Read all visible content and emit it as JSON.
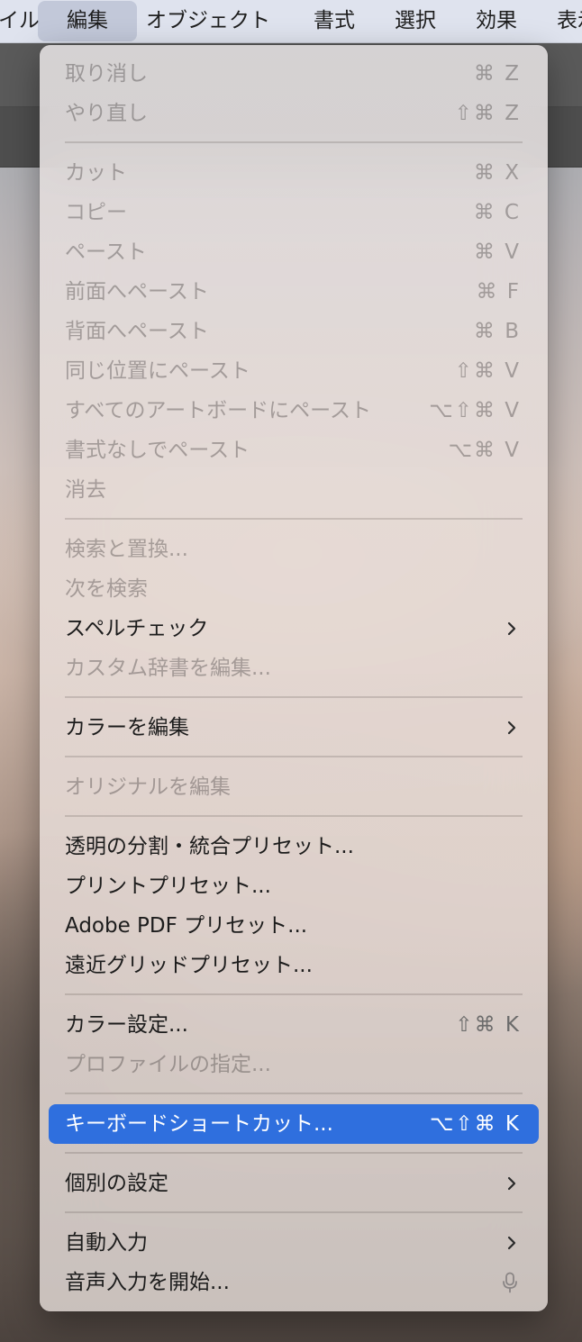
{
  "menubar": {
    "items": [
      {
        "label": "イル"
      },
      {
        "label": "編集"
      },
      {
        "label": "オブジェクト"
      },
      {
        "label": "書式"
      },
      {
        "label": "選択"
      },
      {
        "label": "効果"
      },
      {
        "label": "表示"
      }
    ]
  },
  "menu": {
    "undo": {
      "label": "取り消し",
      "shortcut": "⌘ Z"
    },
    "redo": {
      "label": "やり直し",
      "shortcut": "⇧⌘ Z"
    },
    "cut": {
      "label": "カット",
      "shortcut": "⌘ X"
    },
    "copy": {
      "label": "コピー",
      "shortcut": "⌘ C"
    },
    "paste": {
      "label": "ペースト",
      "shortcut": "⌘ V"
    },
    "paste_front": {
      "label": "前面へペースト",
      "shortcut": "⌘ F"
    },
    "paste_back": {
      "label": "背面へペースト",
      "shortcut": "⌘ B"
    },
    "paste_in_place": {
      "label": "同じ位置にペースト",
      "shortcut": "⇧⌘ V"
    },
    "paste_all_artboards": {
      "label": "すべてのアートボードにペースト",
      "shortcut": "⌥⇧⌘ V"
    },
    "paste_without_formatting": {
      "label": "書式なしでペースト",
      "shortcut": "⌥⌘ V"
    },
    "clear": {
      "label": "消去"
    },
    "find_replace": {
      "label": "検索と置換..."
    },
    "find_next": {
      "label": "次を検索"
    },
    "spelling": {
      "label": "スペルチェック"
    },
    "edit_custom_dictionary": {
      "label": "カスタム辞書を編集..."
    },
    "edit_colors": {
      "label": "カラーを編集"
    },
    "edit_original": {
      "label": "オリジナルを編集"
    },
    "transparency_flattener_presets": {
      "label": "透明の分割・統合プリセット..."
    },
    "print_presets": {
      "label": "プリントプリセット..."
    },
    "adobe_pdf_presets": {
      "label": "Adobe PDF プリセット..."
    },
    "perspective_grid_presets": {
      "label": "遠近グリッドプリセット..."
    },
    "color_settings": {
      "label": "カラー設定...",
      "shortcut": "⇧⌘ K"
    },
    "assign_profile": {
      "label": "プロファイルの指定..."
    },
    "keyboard_shortcuts": {
      "label": "キーボードショートカット...",
      "shortcut": "⌥⇧⌘ K"
    },
    "preferences": {
      "label": "個別の設定"
    },
    "autofill": {
      "label": "自動入力"
    },
    "start_dictation": {
      "label": "音声入力を開始..."
    }
  },
  "icons": {
    "submenu": "chevron-right-icon",
    "dictation": "microphone-icon"
  },
  "colors": {
    "highlight": "#2f6fde",
    "disabled_text": "rgba(60,55,55,0.38)"
  }
}
